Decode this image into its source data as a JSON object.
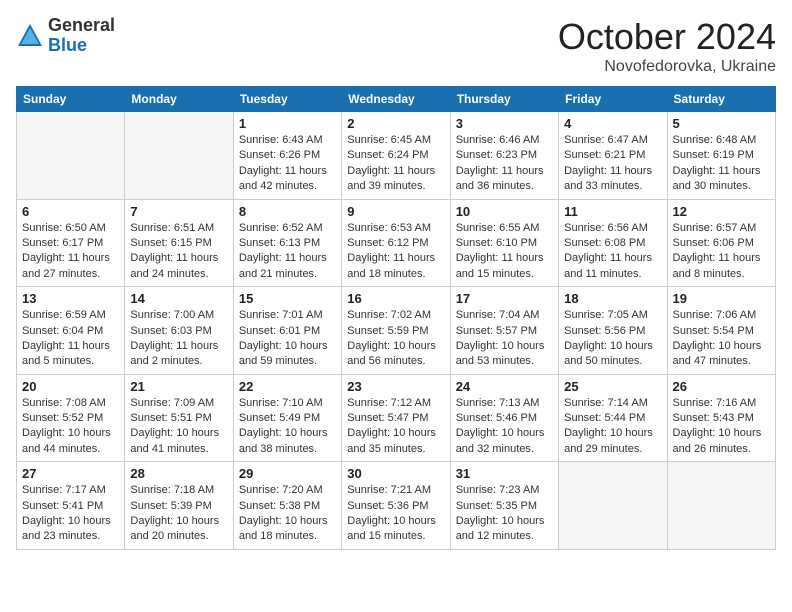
{
  "header": {
    "logo_general": "General",
    "logo_blue": "Blue",
    "month": "October 2024",
    "location": "Novofedorovka, Ukraine"
  },
  "weekdays": [
    "Sunday",
    "Monday",
    "Tuesday",
    "Wednesday",
    "Thursday",
    "Friday",
    "Saturday"
  ],
  "weeks": [
    [
      {
        "day": "",
        "info": ""
      },
      {
        "day": "",
        "info": ""
      },
      {
        "day": "1",
        "info": "Sunrise: 6:43 AM\nSunset: 6:26 PM\nDaylight: 11 hours and 42 minutes."
      },
      {
        "day": "2",
        "info": "Sunrise: 6:45 AM\nSunset: 6:24 PM\nDaylight: 11 hours and 39 minutes."
      },
      {
        "day": "3",
        "info": "Sunrise: 6:46 AM\nSunset: 6:23 PM\nDaylight: 11 hours and 36 minutes."
      },
      {
        "day": "4",
        "info": "Sunrise: 6:47 AM\nSunset: 6:21 PM\nDaylight: 11 hours and 33 minutes."
      },
      {
        "day": "5",
        "info": "Sunrise: 6:48 AM\nSunset: 6:19 PM\nDaylight: 11 hours and 30 minutes."
      }
    ],
    [
      {
        "day": "6",
        "info": "Sunrise: 6:50 AM\nSunset: 6:17 PM\nDaylight: 11 hours and 27 minutes."
      },
      {
        "day": "7",
        "info": "Sunrise: 6:51 AM\nSunset: 6:15 PM\nDaylight: 11 hours and 24 minutes."
      },
      {
        "day": "8",
        "info": "Sunrise: 6:52 AM\nSunset: 6:13 PM\nDaylight: 11 hours and 21 minutes."
      },
      {
        "day": "9",
        "info": "Sunrise: 6:53 AM\nSunset: 6:12 PM\nDaylight: 11 hours and 18 minutes."
      },
      {
        "day": "10",
        "info": "Sunrise: 6:55 AM\nSunset: 6:10 PM\nDaylight: 11 hours and 15 minutes."
      },
      {
        "day": "11",
        "info": "Sunrise: 6:56 AM\nSunset: 6:08 PM\nDaylight: 11 hours and 11 minutes."
      },
      {
        "day": "12",
        "info": "Sunrise: 6:57 AM\nSunset: 6:06 PM\nDaylight: 11 hours and 8 minutes."
      }
    ],
    [
      {
        "day": "13",
        "info": "Sunrise: 6:59 AM\nSunset: 6:04 PM\nDaylight: 11 hours and 5 minutes."
      },
      {
        "day": "14",
        "info": "Sunrise: 7:00 AM\nSunset: 6:03 PM\nDaylight: 11 hours and 2 minutes."
      },
      {
        "day": "15",
        "info": "Sunrise: 7:01 AM\nSunset: 6:01 PM\nDaylight: 10 hours and 59 minutes."
      },
      {
        "day": "16",
        "info": "Sunrise: 7:02 AM\nSunset: 5:59 PM\nDaylight: 10 hours and 56 minutes."
      },
      {
        "day": "17",
        "info": "Sunrise: 7:04 AM\nSunset: 5:57 PM\nDaylight: 10 hours and 53 minutes."
      },
      {
        "day": "18",
        "info": "Sunrise: 7:05 AM\nSunset: 5:56 PM\nDaylight: 10 hours and 50 minutes."
      },
      {
        "day": "19",
        "info": "Sunrise: 7:06 AM\nSunset: 5:54 PM\nDaylight: 10 hours and 47 minutes."
      }
    ],
    [
      {
        "day": "20",
        "info": "Sunrise: 7:08 AM\nSunset: 5:52 PM\nDaylight: 10 hours and 44 minutes."
      },
      {
        "day": "21",
        "info": "Sunrise: 7:09 AM\nSunset: 5:51 PM\nDaylight: 10 hours and 41 minutes."
      },
      {
        "day": "22",
        "info": "Sunrise: 7:10 AM\nSunset: 5:49 PM\nDaylight: 10 hours and 38 minutes."
      },
      {
        "day": "23",
        "info": "Sunrise: 7:12 AM\nSunset: 5:47 PM\nDaylight: 10 hours and 35 minutes."
      },
      {
        "day": "24",
        "info": "Sunrise: 7:13 AM\nSunset: 5:46 PM\nDaylight: 10 hours and 32 minutes."
      },
      {
        "day": "25",
        "info": "Sunrise: 7:14 AM\nSunset: 5:44 PM\nDaylight: 10 hours and 29 minutes."
      },
      {
        "day": "26",
        "info": "Sunrise: 7:16 AM\nSunset: 5:43 PM\nDaylight: 10 hours and 26 minutes."
      }
    ],
    [
      {
        "day": "27",
        "info": "Sunrise: 7:17 AM\nSunset: 5:41 PM\nDaylight: 10 hours and 23 minutes."
      },
      {
        "day": "28",
        "info": "Sunrise: 7:18 AM\nSunset: 5:39 PM\nDaylight: 10 hours and 20 minutes."
      },
      {
        "day": "29",
        "info": "Sunrise: 7:20 AM\nSunset: 5:38 PM\nDaylight: 10 hours and 18 minutes."
      },
      {
        "day": "30",
        "info": "Sunrise: 7:21 AM\nSunset: 5:36 PM\nDaylight: 10 hours and 15 minutes."
      },
      {
        "day": "31",
        "info": "Sunrise: 7:23 AM\nSunset: 5:35 PM\nDaylight: 10 hours and 12 minutes."
      },
      {
        "day": "",
        "info": ""
      },
      {
        "day": "",
        "info": ""
      }
    ]
  ]
}
